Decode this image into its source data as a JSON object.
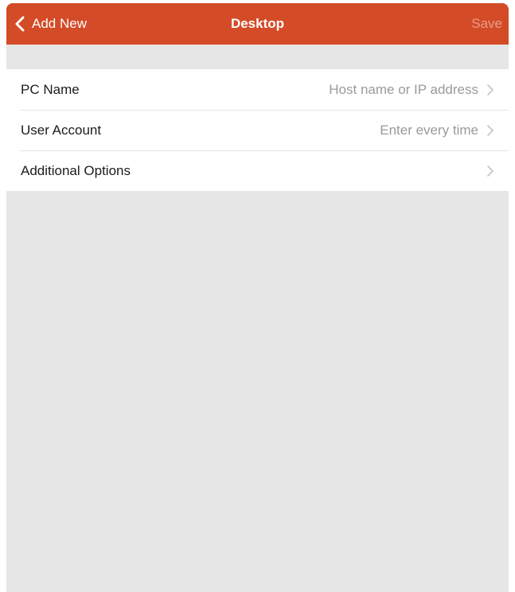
{
  "colors": {
    "accent": "#d44b27",
    "background": "#e6e6e6",
    "list_bg": "#ffffff",
    "value_text": "#9a9a9a"
  },
  "navbar": {
    "back_label": "Add New",
    "back_icon": "chevron-left-icon",
    "title": "Desktop",
    "save_label": "Save"
  },
  "rows": [
    {
      "label": "PC Name",
      "value": "Host name or IP address",
      "icon": "chevron-right-icon"
    },
    {
      "label": "User Account",
      "value": "Enter every time",
      "icon": "chevron-right-icon"
    },
    {
      "label": "Additional Options",
      "value": "",
      "icon": "chevron-right-icon"
    }
  ]
}
